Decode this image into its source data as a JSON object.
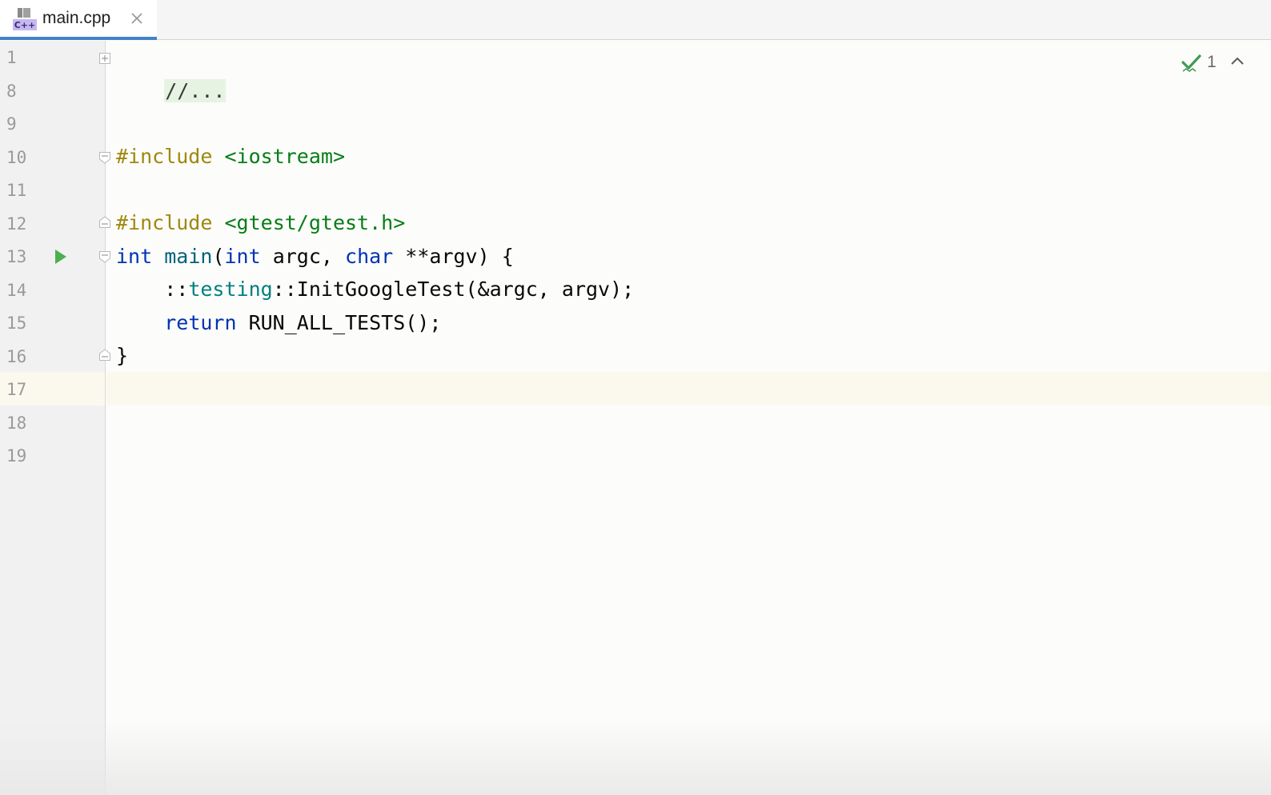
{
  "tab": {
    "label": "main.cpp",
    "icon": "cpp-file-icon",
    "icon_text": "C++"
  },
  "gutter": {
    "line_numbers": [
      "1",
      "8",
      "9",
      "10",
      "11",
      "12",
      "13",
      "14",
      "15",
      "16",
      "17",
      "18",
      "19"
    ]
  },
  "code": {
    "l1": "//...",
    "l10_pp": "#include",
    "l10_str": "<iostream>",
    "l12_pp": "#include",
    "l12_str": "<gtest/gtest.h>",
    "l13_kw1": "int",
    "l13_fn": "main",
    "l13_p1": "(",
    "l13_kw2": "int",
    "l13_p2": " argc, ",
    "l13_kw3": "char",
    "l13_p3": " **argv) {",
    "l14_p1": "    ::",
    "l14_ns": "testing",
    "l14_p2": "::InitGoogleTest(&argc, argv);",
    "l15_kw": "return",
    "l15_p": " RUN_ALL_TESTS();",
    "l16": "}"
  },
  "inspection": {
    "count": "1",
    "icon": "check-inspection-icon"
  },
  "colors": {
    "keyword": "#0033b3",
    "preprocessor": "#9e880d",
    "string": "#067d17",
    "function": "#00627a",
    "namespace": "#008080",
    "run": "#4caf50",
    "tab_accent": "#4083c9"
  }
}
